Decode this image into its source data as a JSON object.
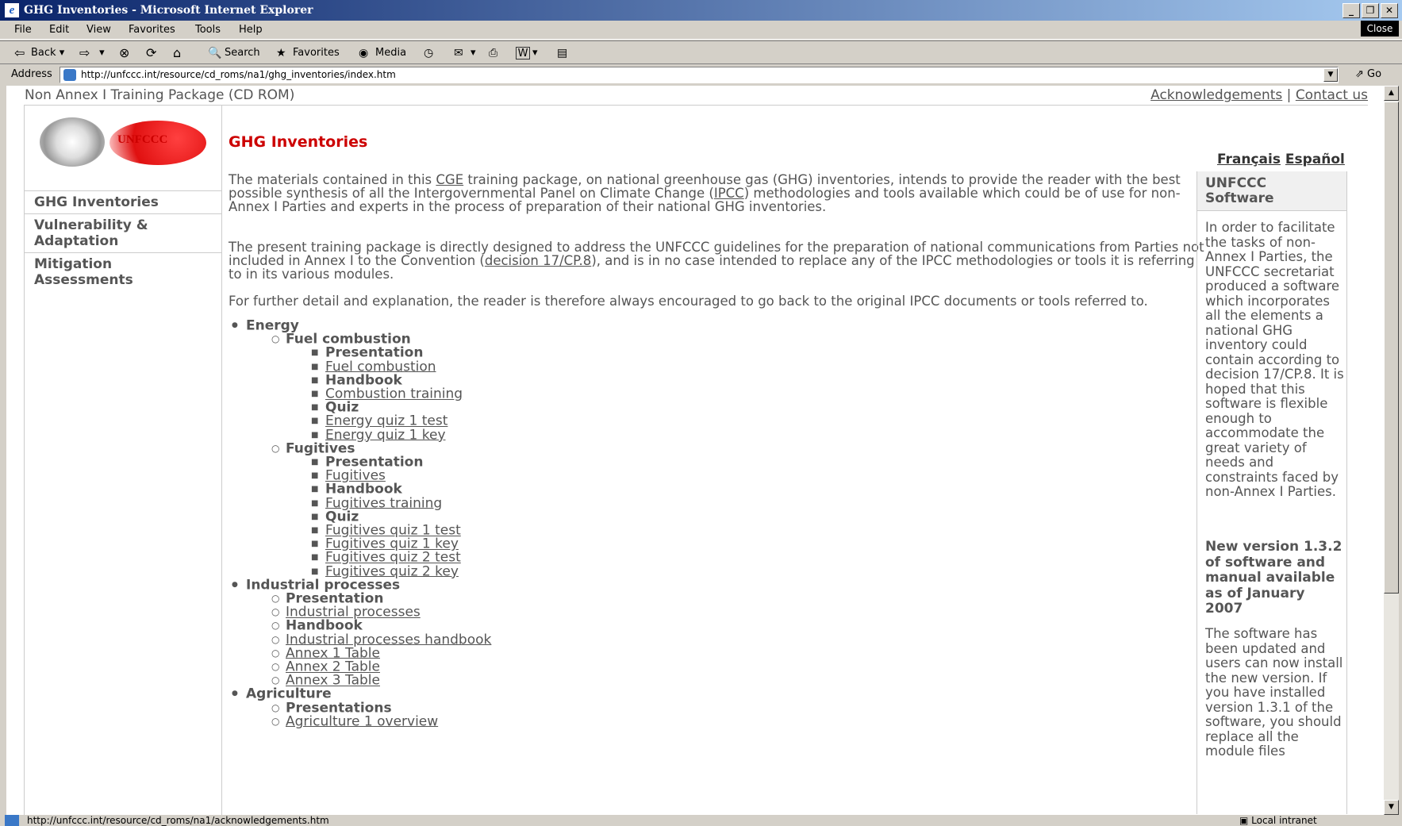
{
  "window": {
    "title": "GHG Inventories - Microsoft Internet Explorer",
    "close_label": "Close"
  },
  "menu": [
    "File",
    "Edit",
    "View",
    "Favorites",
    "Tools",
    "Help"
  ],
  "toolbar": {
    "back": "Back",
    "search": "Search",
    "favorites": "Favorites",
    "media": "Media"
  },
  "address": {
    "label": "Address",
    "url": "http://unfccc.int/resource/cd_roms/na1/ghg_inventories/index.htm",
    "go": "Go"
  },
  "page": {
    "header_left": "Non Annex I Training Package (CD ROM)",
    "ack": "Acknowledgements",
    "sep": "|",
    "contact": "Contact us",
    "logo_text": "UNFCCC",
    "title": "GHG Inventories",
    "lang_fr": "Français",
    "lang_es": "Español",
    "nav": [
      "GHG Inventories",
      "Vulnerability & Adaptation",
      "Mitigation Assessments"
    ],
    "para1_a": "The materials contained in this ",
    "para1_link1": "CGE",
    "para1_b": " training package, on national greenhouse gas (GHG) inventories, intends to provide the reader with the best possible synthesis of all the Intergovernmental Panel on Climate Change (",
    "para1_link2": "IPCC",
    "para1_c": ") methodologies and tools available which could be of use for non-Annex I Parties and experts in the process of preparation of their national GHG inventories.",
    "para2_a": "The present training package is directly designed to address the UNFCCC guidelines for the preparation of national communications from Parties not included in Annex I to the Convention (",
    "para2_link": "decision 17/CP.8",
    "para2_b": "), and is in no case intended to replace any of the IPCC methodologies or tools it is referring to in its various modules.",
    "para3": "For further detail and explanation, the reader is therefore always encouraged to go back to the original IPCC documents or tools referred to.",
    "tree": [
      {
        "level": 1,
        "text": "Energy",
        "bold": true,
        "link": false
      },
      {
        "level": 2,
        "text": "Fuel combustion",
        "bold": true,
        "link": false
      },
      {
        "level": 3,
        "text": "Presentation",
        "bold": true,
        "link": false
      },
      {
        "level": 3,
        "text": "Fuel combustion",
        "bold": false,
        "link": true
      },
      {
        "level": 3,
        "text": "Handbook",
        "bold": true,
        "link": false
      },
      {
        "level": 3,
        "text": "Combustion training",
        "bold": false,
        "link": true
      },
      {
        "level": 3,
        "text": "Quiz",
        "bold": true,
        "link": false
      },
      {
        "level": 3,
        "text": "Energy quiz 1 test",
        "bold": false,
        "link": true
      },
      {
        "level": 3,
        "text": "Energy quiz 1 key",
        "bold": false,
        "link": true
      },
      {
        "level": 2,
        "text": "Fugitives",
        "bold": true,
        "link": false
      },
      {
        "level": 3,
        "text": "Presentation",
        "bold": true,
        "link": false
      },
      {
        "level": 3,
        "text": "Fugitives",
        "bold": false,
        "link": true
      },
      {
        "level": 3,
        "text": "Handbook",
        "bold": true,
        "link": false
      },
      {
        "level": 3,
        "text": "Fugitives training",
        "bold": false,
        "link": true
      },
      {
        "level": 3,
        "text": "Quiz",
        "bold": true,
        "link": false
      },
      {
        "level": 3,
        "text": "Fugitives quiz 1 test",
        "bold": false,
        "link": true
      },
      {
        "level": 3,
        "text": "Fugitives quiz 1 key",
        "bold": false,
        "link": true
      },
      {
        "level": 3,
        "text": "Fugitives quiz 2 test",
        "bold": false,
        "link": true
      },
      {
        "level": 3,
        "text": "Fugitives quiz 2 key",
        "bold": false,
        "link": true
      },
      {
        "level": 1,
        "text": "Industrial processes",
        "bold": true,
        "link": false
      },
      {
        "level": 2,
        "text": "Presentation",
        "bold": true,
        "link": false
      },
      {
        "level": 2,
        "text": "Industrial processes",
        "bold": false,
        "link": true
      },
      {
        "level": 2,
        "text": "Handbook",
        "bold": true,
        "link": false
      },
      {
        "level": 2,
        "text": "Industrial processes handbook",
        "bold": false,
        "link": true
      },
      {
        "level": 2,
        "text": "Annex 1 Table",
        "bold": false,
        "link": true
      },
      {
        "level": 2,
        "text": "Annex 2 Table",
        "bold": false,
        "link": true
      },
      {
        "level": 2,
        "text": "Annex 3 Table",
        "bold": false,
        "link": true
      },
      {
        "level": 1,
        "text": "Agriculture",
        "bold": true,
        "link": false
      },
      {
        "level": 2,
        "text": "Presentations",
        "bold": true,
        "link": false
      },
      {
        "level": 2,
        "text": "Agriculture 1 overview",
        "bold": false,
        "link": true
      }
    ],
    "right_panel": {
      "heading": "UNFCCC Software",
      "body": "In order to facilitate the tasks of non-Annex I Parties, the UNFCCC secretariat produced a software which incorporates all the elements a national GHG inventory could contain according to decision 17/CP.8. It is hoped that this software is flexible enough to accommodate the great variety of needs and constraints faced by non-Annex I Parties.",
      "bold": "New version 1.3.2 of software and manual available as of January 2007",
      "body2": "The software has been updated and users can now install the new version. If you have installed version 1.3.1 of the software, you should replace all the module files"
    }
  },
  "status": {
    "url": "http://unfccc.int/resource/cd_roms/na1/acknowledgements.htm",
    "zone": "Local intranet"
  }
}
